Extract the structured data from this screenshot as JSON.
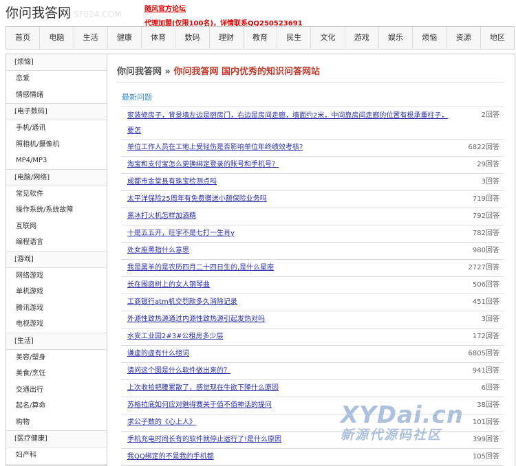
{
  "header": {
    "logo": "你问我答网",
    "logo_ghost": "SF024.COM",
    "promo_line1": "随风官方论坛",
    "promo_line2": "代理加盟(仅限100名)，详情联系QQ250523691"
  },
  "nav": [
    "首页",
    "电脑",
    "生活",
    "健康",
    "体育",
    "数码",
    "理财",
    "教育",
    "民生",
    "文化",
    "游戏",
    "娱乐",
    "烦恼",
    "资源",
    "地区"
  ],
  "sidebar": [
    {
      "head": "[烦恼]",
      "items": [
        "恋爱",
        "情感情绪"
      ]
    },
    {
      "head": "[电子数码]",
      "items": [
        "手机/通讯",
        "照相机/摄像机",
        "MP4/MP3"
      ]
    },
    {
      "head": "[电脑/网络]",
      "items": [
        "常见软件",
        "操作系统/系统故障",
        "互联网",
        "编程语言"
      ]
    },
    {
      "head": "[游戏]",
      "items": [
        "网络游戏",
        "单机游戏",
        "腾讯游戏",
        "电视游戏"
      ]
    },
    {
      "head": "[生活]",
      "items": [
        "美容/塑身",
        "美食/烹饪",
        "交通出行",
        "起名/算命",
        "购物"
      ]
    },
    {
      "head": "[医疗健康]",
      "items": [
        "妇产科"
      ]
    }
  ],
  "breadcrumb": {
    "site": "你问我答网",
    "sep": "»",
    "current": "你问我答网 国内优秀的知识问答网站"
  },
  "section_title": "最新问题",
  "questions": [
    {
      "title": "家装修房子，背景墙左边是厨房门，右边是房间走廊，墙面约2米，中间靠房间走廊的位置有根承重柱子，要怎",
      "count": "2回答"
    },
    {
      "title": "单位工作人员在工地上受轻伤是否影响单位年终绩效考核?",
      "count": "6822回答"
    },
    {
      "title": "淘宝和支付宝怎么更换绑定登录的账号和手机号？",
      "count": "29回答"
    },
    {
      "title": "成都市金堂县有珠宝检测点吗",
      "count": "3回答"
    },
    {
      "title": "太平洋保险25周年有免费赠送小额保险业务吗",
      "count": "719回答"
    },
    {
      "title": "黑冰打火机怎样加酒精",
      "count": "792回答"
    },
    {
      "title": "十是五五开，旺字不是七打一生肖y",
      "count": "782回答"
    },
    {
      "title": "处女座黑指什么意思",
      "count": "980回答"
    },
    {
      "title": "我是属羊的是农历四月二十四日生的,是什么星座",
      "count": "2727回答"
    },
    {
      "title": "长在围囱树上的女人钢琴曲",
      "count": "506回答"
    },
    {
      "title": "工商银行atm机交罚款多久消除记录",
      "count": "451回答"
    },
    {
      "title": "外源性致热源通过内源性致热源引起发热对吗",
      "count": "3回答"
    },
    {
      "title": "水安工业园2#3#公租房多少层",
      "count": "172回答"
    },
    {
      "title": "谦虚的虚有什么组词",
      "count": "6805回答"
    },
    {
      "title": "请问这个图是什么软件做出来的？",
      "count": "941回答"
    },
    {
      "title": "上次收拾把腰累散了，感觉现在牛欲下降什么原因",
      "count": "6回答"
    },
    {
      "title": "苏格拉底如何应对魅得赛关于值不值神话的提问",
      "count": "38回答"
    },
    {
      "title": "求公子数的《心上人》",
      "count": "101回答"
    },
    {
      "title": "手机充电时间长有的软件就停止运行了!是什么原因",
      "count": "399回答"
    },
    {
      "title": "我QQ绑定的不是我的手机都",
      "count": "105回答"
    }
  ],
  "watermark": {
    "line1": "XYDai.cn",
    "line2": "新源代源码社区"
  }
}
